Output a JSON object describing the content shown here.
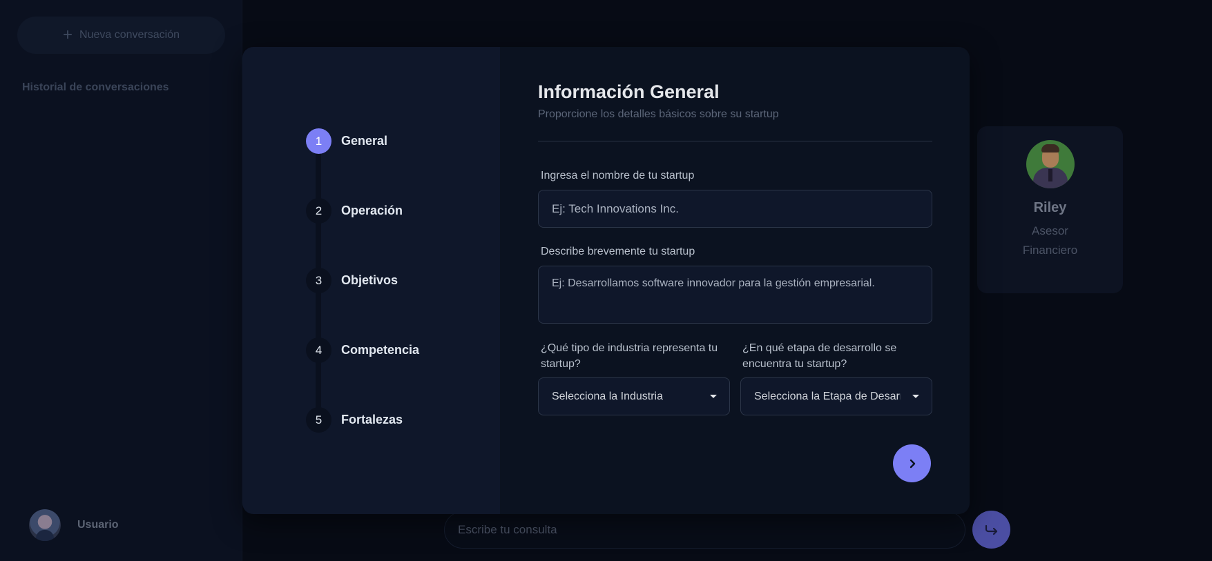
{
  "sidebar": {
    "new_chat_label": "Nueva conversación",
    "new_chat_icon": "plus-icon",
    "history_title": "Historial de conversaciones",
    "user_name": "Usuario"
  },
  "advisor": {
    "name": "Riley",
    "role": "Asesor Financiero"
  },
  "chat": {
    "placeholder": "Escribe tu consulta"
  },
  "wizard": {
    "steps": [
      {
        "num": "1",
        "label": "General"
      },
      {
        "num": "2",
        "label": "Operación"
      },
      {
        "num": "3",
        "label": "Objetivos"
      },
      {
        "num": "4",
        "label": "Competencia"
      },
      {
        "num": "5",
        "label": "Fortalezas"
      }
    ],
    "active_step": 1,
    "title": "Información General",
    "subtitle": "Proporcione los detalles básicos sobre su startup",
    "name_label": "Ingresa el nombre de tu startup",
    "name_placeholder": "Ej: Tech Innovations Inc.",
    "description_label": "Describe brevemente tu startup",
    "description_placeholder": "Ej: Desarrollamos software innovador para la gestión empresarial.",
    "industry_label": "¿Qué tipo de industria representa tu startup?",
    "industry_value": "Selecciona la Industria",
    "stage_label": "¿En qué etapa de desarrollo se encuentra tu startup?",
    "stage_value": "Selecciona la Etapa de Desarrollo"
  },
  "colors": {
    "accent": "#7c7ff5",
    "background": "#070b15",
    "panel": "#0f172a"
  }
}
